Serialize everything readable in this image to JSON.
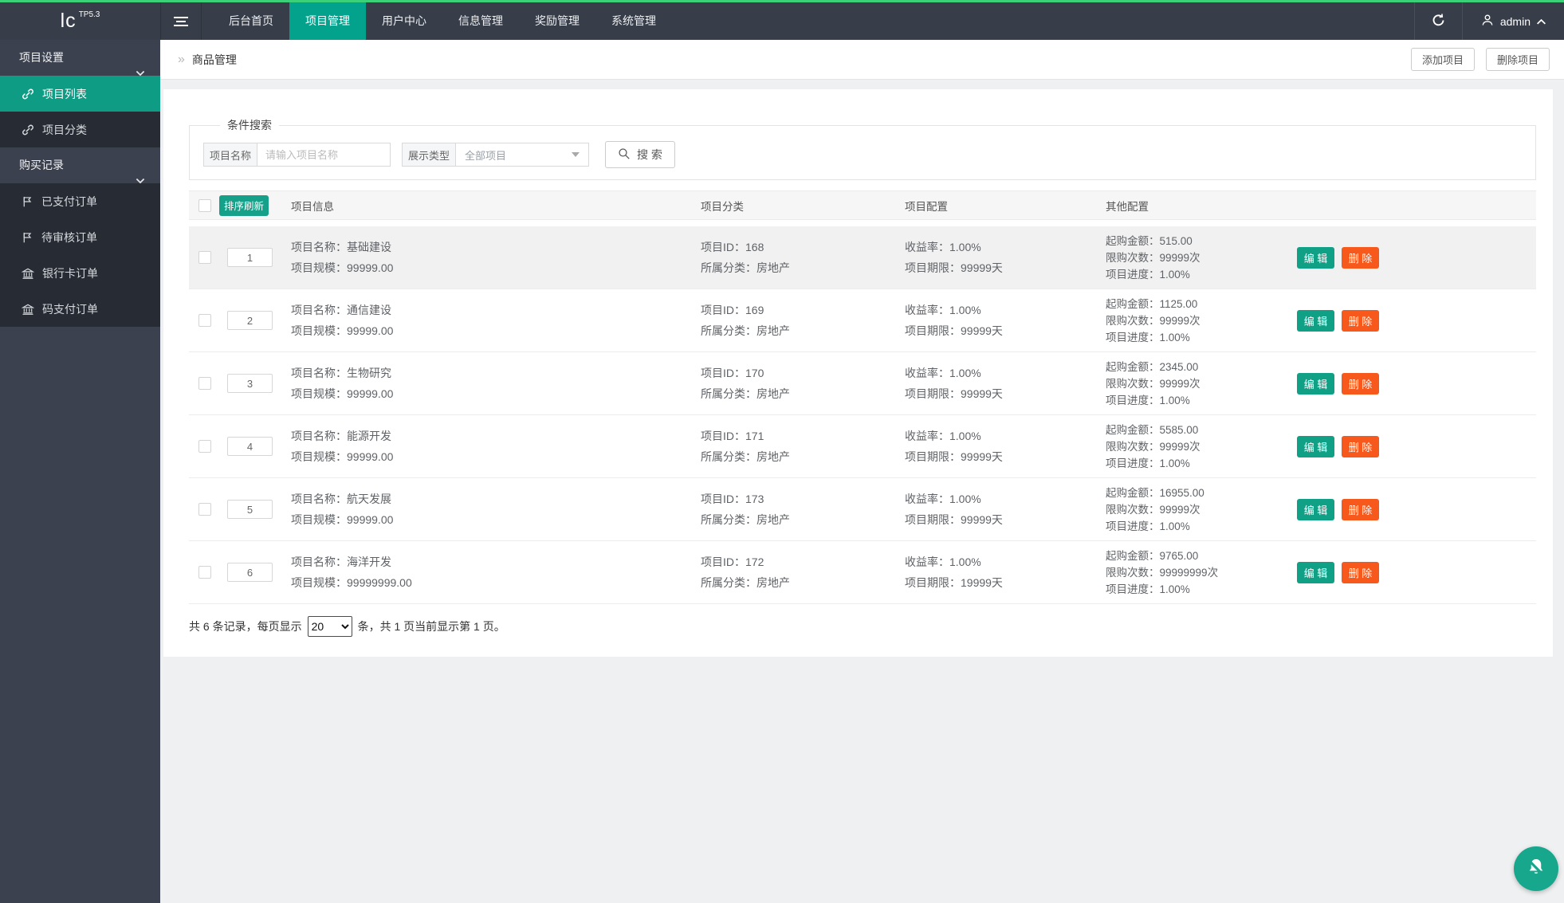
{
  "colors": {
    "top_line": "#3ad179",
    "navbar_bg": "#373d49",
    "nav_active": "#02a28c",
    "sidebar_active": "#0e9c84",
    "teal_button": "#10a086",
    "orange_button": "#f7581c",
    "fab_bg": "#17a78c"
  },
  "navbar": {
    "logo": "lc",
    "logo_version": "TP5.3",
    "menu": [
      {
        "label": "后台首页",
        "active": false
      },
      {
        "label": "项目管理",
        "active": true
      },
      {
        "label": "用户中心",
        "active": false
      },
      {
        "label": "信息管理",
        "active": false
      },
      {
        "label": "奖励管理",
        "active": false
      },
      {
        "label": "系统管理",
        "active": false
      }
    ],
    "username": "admin"
  },
  "sidebar": {
    "groups": [
      {
        "label": "项目设置",
        "items": [
          {
            "icon": "link-icon",
            "label": "项目列表",
            "active": true
          },
          {
            "icon": "link-icon",
            "label": "项目分类",
            "active": false
          }
        ]
      },
      {
        "label": "购买记录",
        "items": [
          {
            "icon": "flag-icon",
            "label": "已支付订单",
            "active": false
          },
          {
            "icon": "flag-icon",
            "label": "待审核订单",
            "active": false
          },
          {
            "icon": "bank-icon",
            "label": "银行卡订单",
            "active": false
          },
          {
            "icon": "bank-icon",
            "label": "码支付订单",
            "active": false
          }
        ]
      }
    ]
  },
  "breadcrumb": {
    "arrows": "»",
    "title": "商品管理"
  },
  "page_actions": {
    "add": "添加项目",
    "remove": "删除项目"
  },
  "search": {
    "legend": "条件搜索",
    "name_label": "项目名称",
    "name_placeholder": "请输入项目名称",
    "type_label": "展示类型",
    "type_value": "全部项目",
    "button_label": "搜 索"
  },
  "table": {
    "sort_refresh": "排序刷新",
    "headers": {
      "info": "项目信息",
      "category": "项目分类",
      "config": "项目配置",
      "other": "其他配置"
    },
    "row_labels": {
      "name": "项目名称：",
      "scale": "项目规模：",
      "id": "项目ID：",
      "cat": "所属分类：",
      "rate": "收益率：",
      "period": "项目期限：",
      "amount": "起购金额：",
      "limit": "限购次数：",
      "progress": "项目进度："
    },
    "edit_label": "编 辑",
    "delete_label": "删 除",
    "rows": [
      {
        "index": "1",
        "name": "基础建设",
        "scale": "99999.00",
        "id": "168",
        "cat": "房地产",
        "rate": "1.00%",
        "period": "99999天",
        "amount": "515.00",
        "limit": "99999次",
        "progress": "1.00%",
        "highlight": true
      },
      {
        "index": "2",
        "name": "通信建设",
        "scale": "99999.00",
        "id": "169",
        "cat": "房地产",
        "rate": "1.00%",
        "period": "99999天",
        "amount": "1125.00",
        "limit": "99999次",
        "progress": "1.00%",
        "highlight": false
      },
      {
        "index": "3",
        "name": "生物研究",
        "scale": "99999.00",
        "id": "170",
        "cat": "房地产",
        "rate": "1.00%",
        "period": "99999天",
        "amount": "2345.00",
        "limit": "99999次",
        "progress": "1.00%",
        "highlight": false
      },
      {
        "index": "4",
        "name": "能源开发",
        "scale": "99999.00",
        "id": "171",
        "cat": "房地产",
        "rate": "1.00%",
        "period": "99999天",
        "amount": "5585.00",
        "limit": "99999次",
        "progress": "1.00%",
        "highlight": false
      },
      {
        "index": "5",
        "name": "航天发展",
        "scale": "99999.00",
        "id": "173",
        "cat": "房地产",
        "rate": "1.00%",
        "period": "99999天",
        "amount": "16955.00",
        "limit": "99999次",
        "progress": "1.00%",
        "highlight": false
      },
      {
        "index": "6",
        "name": "海洋开发",
        "scale": "99999999.00",
        "id": "172",
        "cat": "房地产",
        "rate": "1.00%",
        "period": "19999天",
        "amount": "9765.00",
        "limit": "99999999次",
        "progress": "1.00%",
        "highlight": false
      }
    ]
  },
  "pagination": {
    "prefix": "共 6 条记录，每页显示",
    "page_size": "20",
    "suffix": "条，共 1 页当前显示第 1 页。"
  }
}
